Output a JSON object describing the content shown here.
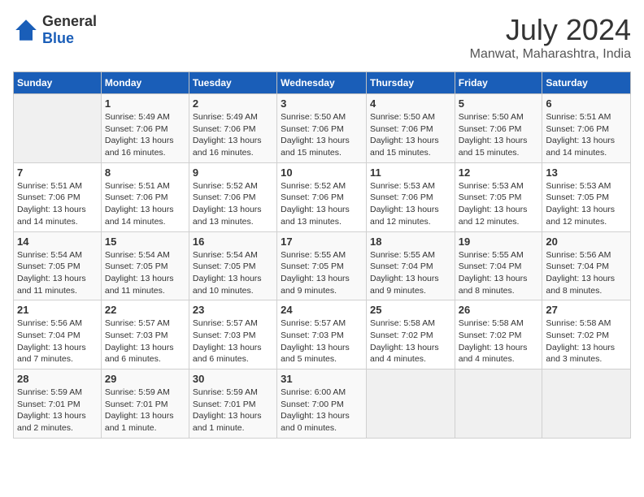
{
  "header": {
    "logo_general": "General",
    "logo_blue": "Blue",
    "month": "July 2024",
    "location": "Manwat, Maharashtra, India"
  },
  "days_of_week": [
    "Sunday",
    "Monday",
    "Tuesday",
    "Wednesday",
    "Thursday",
    "Friday",
    "Saturday"
  ],
  "weeks": [
    [
      {
        "day": "",
        "info": ""
      },
      {
        "day": "1",
        "info": "Sunrise: 5:49 AM\nSunset: 7:06 PM\nDaylight: 13 hours\nand 16 minutes."
      },
      {
        "day": "2",
        "info": "Sunrise: 5:49 AM\nSunset: 7:06 PM\nDaylight: 13 hours\nand 16 minutes."
      },
      {
        "day": "3",
        "info": "Sunrise: 5:50 AM\nSunset: 7:06 PM\nDaylight: 13 hours\nand 15 minutes."
      },
      {
        "day": "4",
        "info": "Sunrise: 5:50 AM\nSunset: 7:06 PM\nDaylight: 13 hours\nand 15 minutes."
      },
      {
        "day": "5",
        "info": "Sunrise: 5:50 AM\nSunset: 7:06 PM\nDaylight: 13 hours\nand 15 minutes."
      },
      {
        "day": "6",
        "info": "Sunrise: 5:51 AM\nSunset: 7:06 PM\nDaylight: 13 hours\nand 14 minutes."
      }
    ],
    [
      {
        "day": "7",
        "info": "Sunrise: 5:51 AM\nSunset: 7:06 PM\nDaylight: 13 hours\nand 14 minutes."
      },
      {
        "day": "8",
        "info": "Sunrise: 5:51 AM\nSunset: 7:06 PM\nDaylight: 13 hours\nand 14 minutes."
      },
      {
        "day": "9",
        "info": "Sunrise: 5:52 AM\nSunset: 7:06 PM\nDaylight: 13 hours\nand 13 minutes."
      },
      {
        "day": "10",
        "info": "Sunrise: 5:52 AM\nSunset: 7:06 PM\nDaylight: 13 hours\nand 13 minutes."
      },
      {
        "day": "11",
        "info": "Sunrise: 5:53 AM\nSunset: 7:06 PM\nDaylight: 13 hours\nand 12 minutes."
      },
      {
        "day": "12",
        "info": "Sunrise: 5:53 AM\nSunset: 7:05 PM\nDaylight: 13 hours\nand 12 minutes."
      },
      {
        "day": "13",
        "info": "Sunrise: 5:53 AM\nSunset: 7:05 PM\nDaylight: 13 hours\nand 12 minutes."
      }
    ],
    [
      {
        "day": "14",
        "info": "Sunrise: 5:54 AM\nSunset: 7:05 PM\nDaylight: 13 hours\nand 11 minutes."
      },
      {
        "day": "15",
        "info": "Sunrise: 5:54 AM\nSunset: 7:05 PM\nDaylight: 13 hours\nand 11 minutes."
      },
      {
        "day": "16",
        "info": "Sunrise: 5:54 AM\nSunset: 7:05 PM\nDaylight: 13 hours\nand 10 minutes."
      },
      {
        "day": "17",
        "info": "Sunrise: 5:55 AM\nSunset: 7:05 PM\nDaylight: 13 hours\nand 9 minutes."
      },
      {
        "day": "18",
        "info": "Sunrise: 5:55 AM\nSunset: 7:04 PM\nDaylight: 13 hours\nand 9 minutes."
      },
      {
        "day": "19",
        "info": "Sunrise: 5:55 AM\nSunset: 7:04 PM\nDaylight: 13 hours\nand 8 minutes."
      },
      {
        "day": "20",
        "info": "Sunrise: 5:56 AM\nSunset: 7:04 PM\nDaylight: 13 hours\nand 8 minutes."
      }
    ],
    [
      {
        "day": "21",
        "info": "Sunrise: 5:56 AM\nSunset: 7:04 PM\nDaylight: 13 hours\nand 7 minutes."
      },
      {
        "day": "22",
        "info": "Sunrise: 5:57 AM\nSunset: 7:03 PM\nDaylight: 13 hours\nand 6 minutes."
      },
      {
        "day": "23",
        "info": "Sunrise: 5:57 AM\nSunset: 7:03 PM\nDaylight: 13 hours\nand 6 minutes."
      },
      {
        "day": "24",
        "info": "Sunrise: 5:57 AM\nSunset: 7:03 PM\nDaylight: 13 hours\nand 5 minutes."
      },
      {
        "day": "25",
        "info": "Sunrise: 5:58 AM\nSunset: 7:02 PM\nDaylight: 13 hours\nand 4 minutes."
      },
      {
        "day": "26",
        "info": "Sunrise: 5:58 AM\nSunset: 7:02 PM\nDaylight: 13 hours\nand 4 minutes."
      },
      {
        "day": "27",
        "info": "Sunrise: 5:58 AM\nSunset: 7:02 PM\nDaylight: 13 hours\nand 3 minutes."
      }
    ],
    [
      {
        "day": "28",
        "info": "Sunrise: 5:59 AM\nSunset: 7:01 PM\nDaylight: 13 hours\nand 2 minutes."
      },
      {
        "day": "29",
        "info": "Sunrise: 5:59 AM\nSunset: 7:01 PM\nDaylight: 13 hours\nand 1 minute."
      },
      {
        "day": "30",
        "info": "Sunrise: 5:59 AM\nSunset: 7:01 PM\nDaylight: 13 hours\nand 1 minute."
      },
      {
        "day": "31",
        "info": "Sunrise: 6:00 AM\nSunset: 7:00 PM\nDaylight: 13 hours\nand 0 minutes."
      },
      {
        "day": "",
        "info": ""
      },
      {
        "day": "",
        "info": ""
      },
      {
        "day": "",
        "info": ""
      }
    ]
  ]
}
